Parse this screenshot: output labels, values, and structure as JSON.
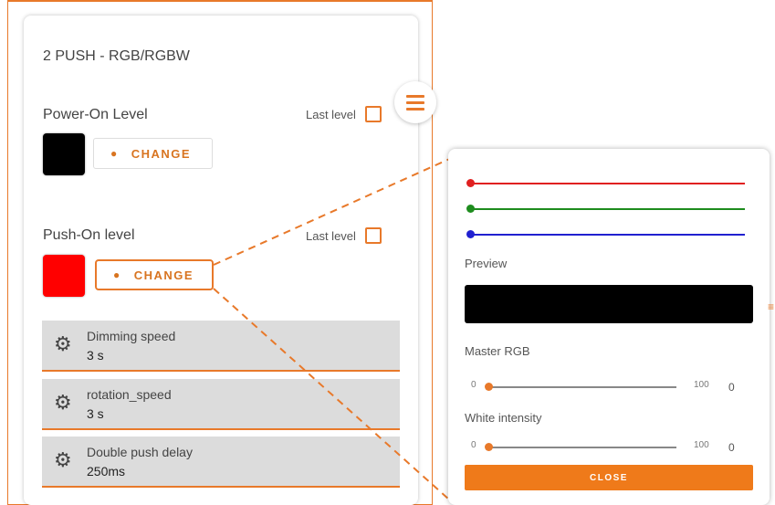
{
  "panel": {
    "title": "2 PUSH - RGB/RGBW"
  },
  "power_on": {
    "label": "Power-On Level",
    "last_level_label": "Last level",
    "last_level_checked": false,
    "swatch_color": "#000000",
    "change_label": "CHANGE"
  },
  "push_on": {
    "label": "Push-On level",
    "last_level_label": "Last level",
    "last_level_checked": false,
    "swatch_color": "#ff0000",
    "change_label": "CHANGE"
  },
  "settings": [
    {
      "name": "Dimming speed",
      "value": "3 s",
      "icon": "gear-icon"
    },
    {
      "name": "rotation_speed",
      "value": "3 s",
      "icon": "gear-icon"
    },
    {
      "name": "Double push delay",
      "value": "250ms",
      "icon": "gear-icon"
    }
  ],
  "color_popup": {
    "channels": [
      {
        "name": "red",
        "color": "#e02020",
        "value": 0
      },
      {
        "name": "green",
        "color": "#1e8c1e",
        "value": 0
      },
      {
        "name": "blue",
        "color": "#2020d0",
        "value": 0
      }
    ],
    "preview_label": "Preview",
    "preview_color": "#000000",
    "master": {
      "label": "Master RGB",
      "min": "0",
      "max": "100",
      "value": "0"
    },
    "white": {
      "label": "White intensity",
      "min": "0",
      "max": "100",
      "value": "0"
    },
    "close_label": "CLOSE"
  },
  "colors": {
    "accent": "#e8792a",
    "setting_bg": "#dcdcdc"
  }
}
